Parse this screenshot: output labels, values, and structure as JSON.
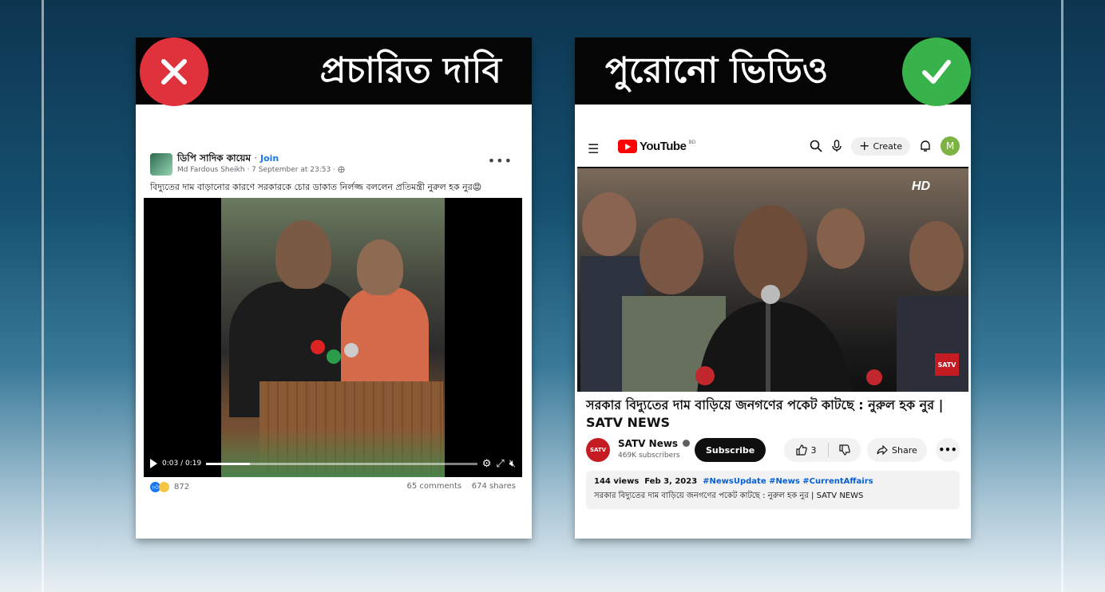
{
  "left_panel": {
    "heading": "প্রচারিত দাবি",
    "facebook_post": {
      "group_name": "ডিপি সাদিক কায়েম",
      "join_label": "Join",
      "author_line": "Md Fardous Sheikh · 7 September at 23:53 · ",
      "caption": "বিদ্যুতের দাম বাড়ানোর কারণে সরকারকে চোর ডাকাত নির্লজ্জ বললেন প্রতিমন্ত্রী নুরুল হক নুর😡",
      "video_time": "0:03 / 0:19",
      "reaction_count": "872",
      "comments": "65 comments",
      "shares": "674 shares"
    }
  },
  "right_panel": {
    "heading": "পুরোনো ভিডিও",
    "youtube": {
      "logo_text": "YouTube",
      "country_code": "BD",
      "create_label": "Create",
      "avatar_letter": "M",
      "hd_label": "HD",
      "overlay_logo": "SATV",
      "title": "সরকার বিদ্যুতের দাম বাড়িয়ে জনগণের পকেট কাটছে : নুরুল হক নুর | SATV NEWS",
      "channel_name": "SATV News",
      "channel_avatar_text": "SATV",
      "subscribers": "469K subscribers",
      "subscribe_label": "Subscribe",
      "like_count": "3",
      "share_label": "Share",
      "views": "144 views",
      "date": "Feb 3, 2023",
      "hashtags": "#NewsUpdate #News #CurrentAffairs",
      "description": "সরকার বিদ্যুতের দাম বাড়িয়ে জনগণের পকেট কাটছে : নুরুল হক নুর | SATV NEWS"
    }
  },
  "colors": {
    "claim_badge": "#e0323c",
    "fact_badge": "#38b24a",
    "banner": "#050505",
    "facebook_blue": "#1877f2",
    "youtube_red": "#ff0000"
  },
  "video_progress": 0.16
}
